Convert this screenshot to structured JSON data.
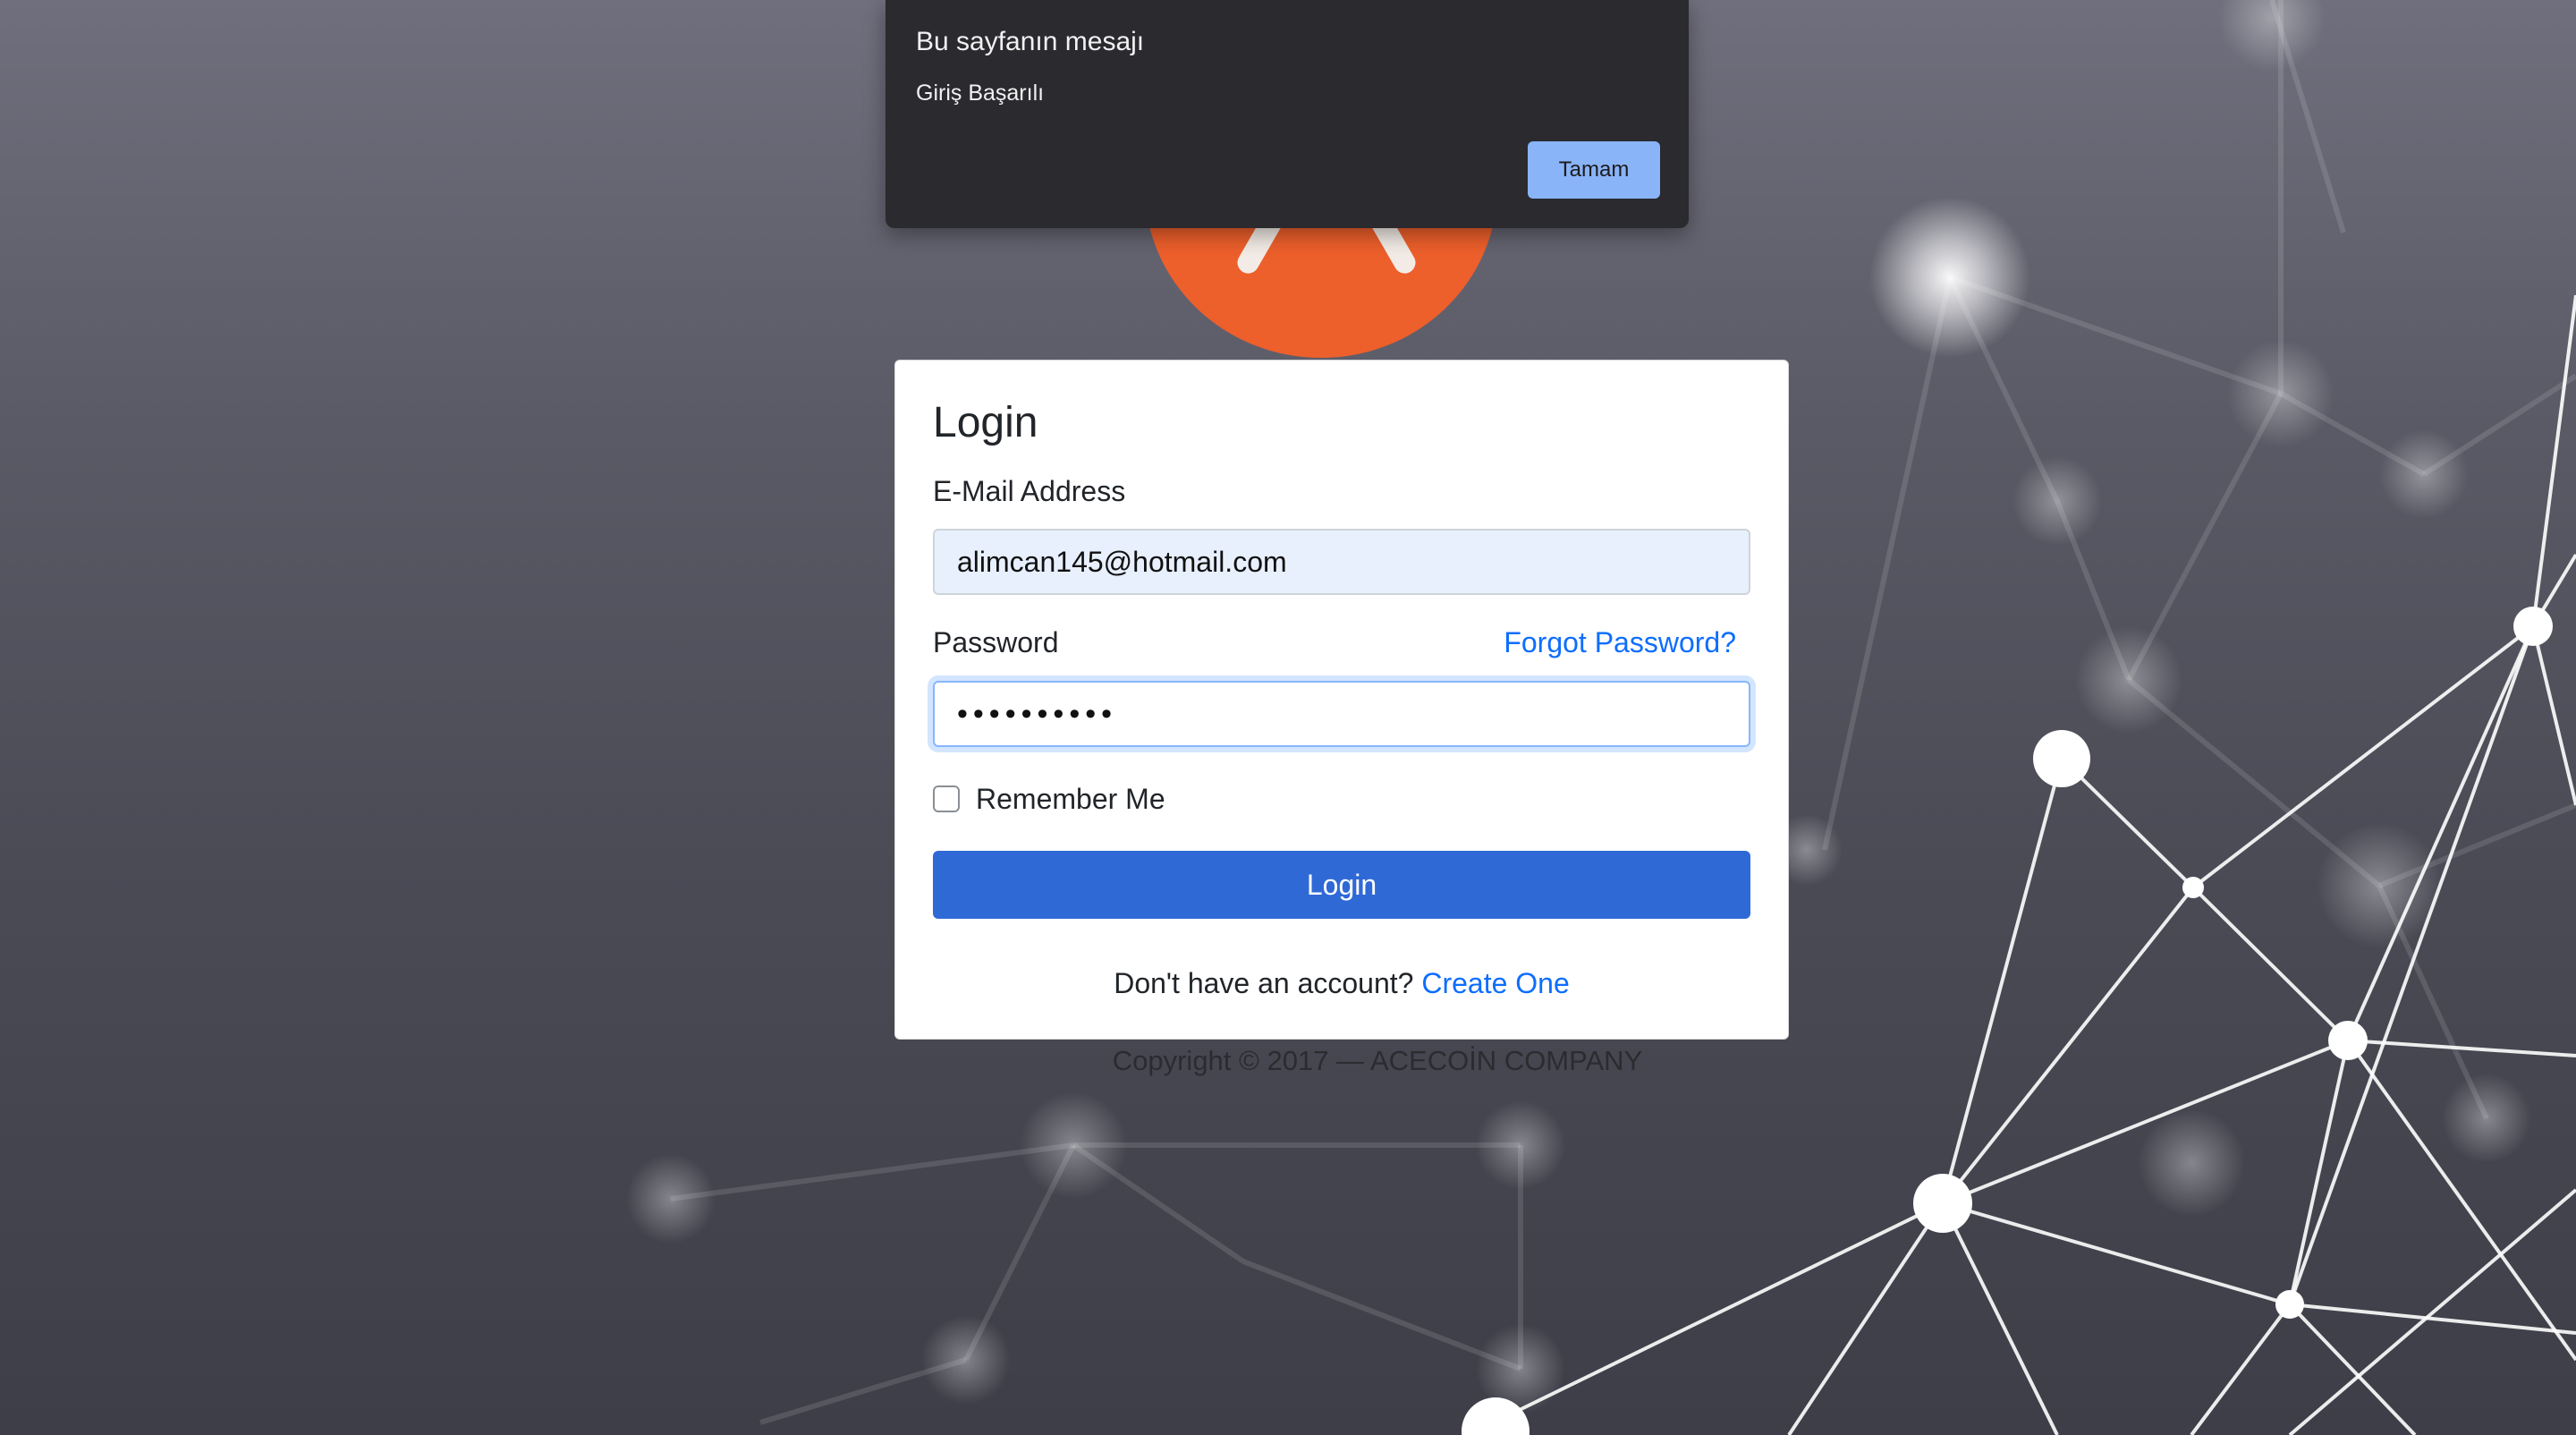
{
  "dialog": {
    "title": "Bu sayfanın mesajı",
    "message": "Giriş Başarılı",
    "ok_label": "Tamam"
  },
  "login": {
    "title": "Login",
    "email_label": "E-Mail Address",
    "email_value": "alimcan145@hotmail.com",
    "password_label": "Password",
    "forgot_label": "Forgot Password?",
    "password_mask": "••••••••••",
    "remember_label": "Remember Me",
    "remember_checked": false,
    "submit_label": "Login",
    "signup_prompt": "Don't have an account?",
    "signup_link": "Create One"
  },
  "footer": {
    "copyright": "Copyright © 2017 — ACECOİN COMPANY"
  },
  "colors": {
    "primary": "#2f69d6",
    "link": "#0d6efd",
    "logo": "#ed5f2b",
    "dialog_bg": "#2a2a2f",
    "dialog_button": "#8ab4f8"
  },
  "icons": {
    "logo": "orange-circle-logo-icon"
  }
}
